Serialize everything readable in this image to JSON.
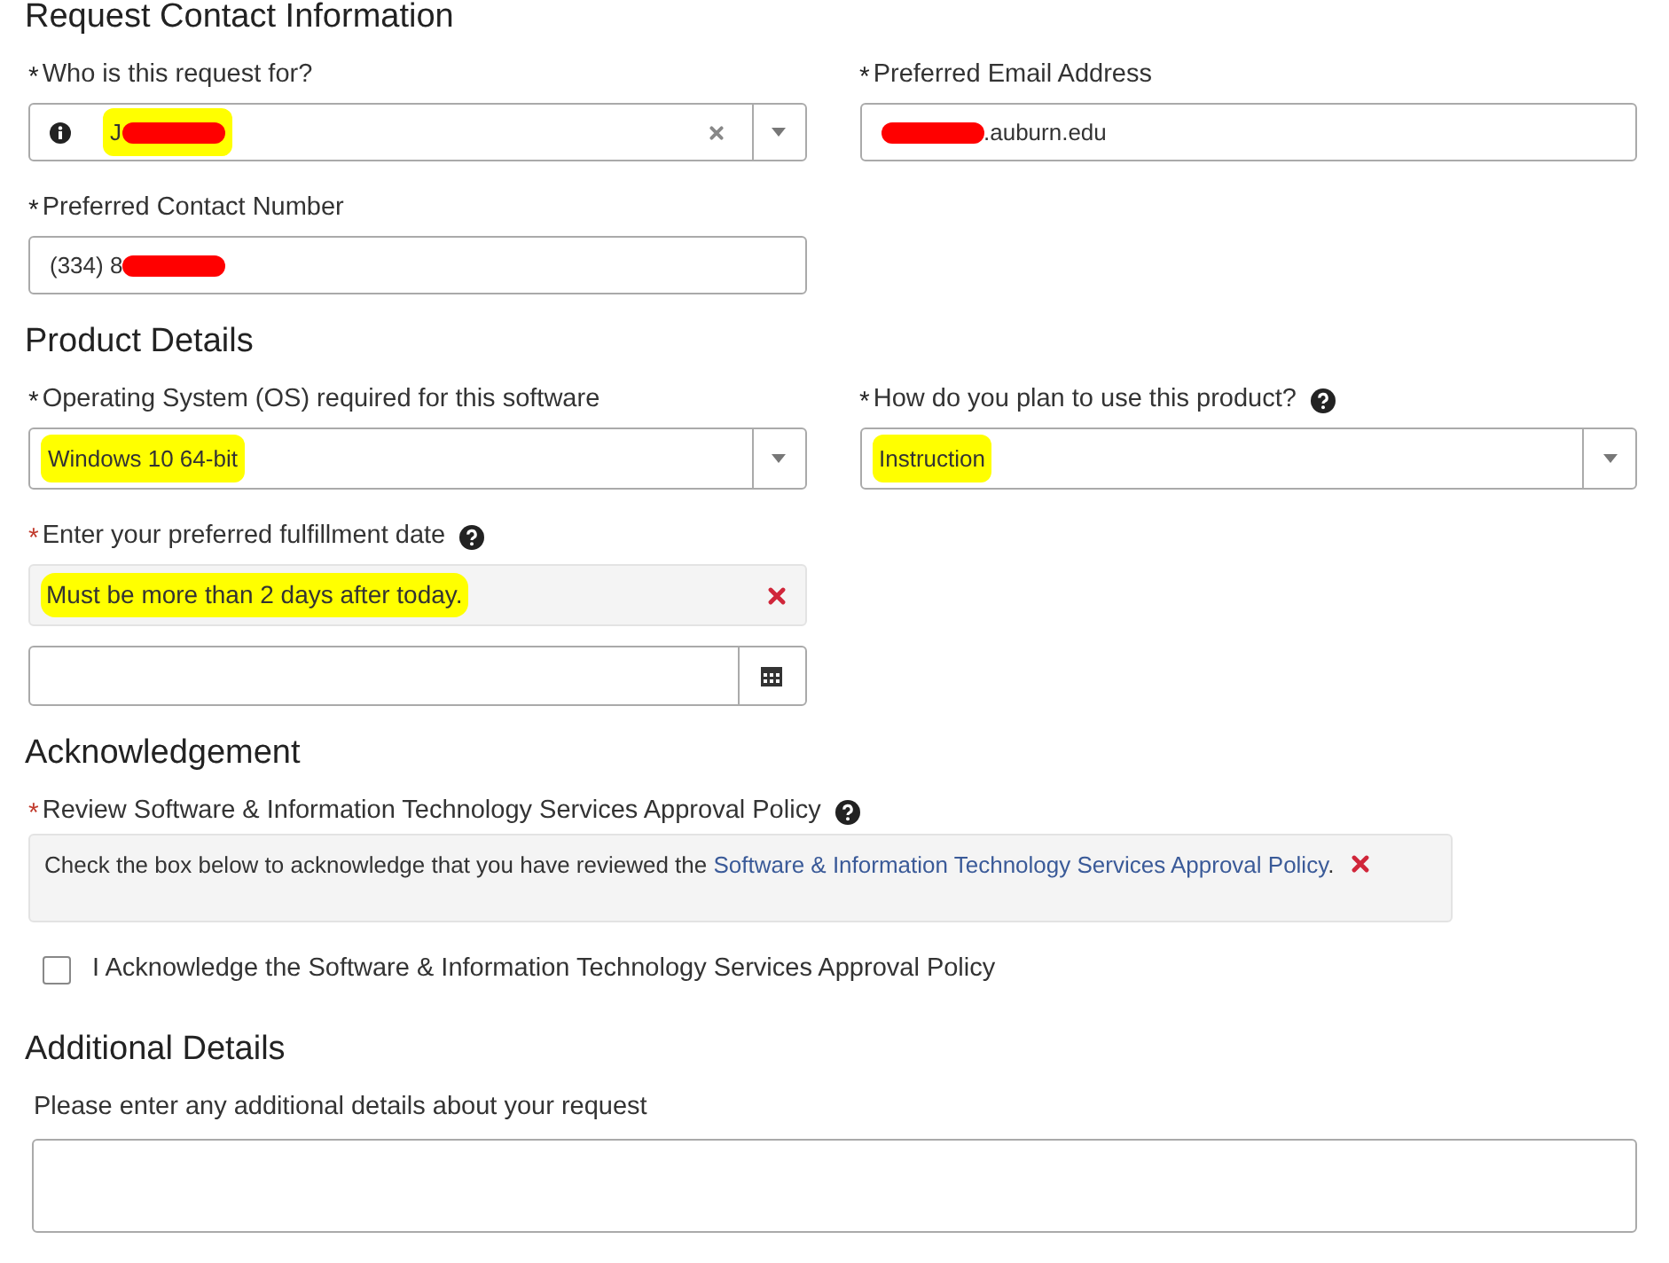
{
  "sections": [
    {
      "title": "Request Contact Information",
      "left": [
        {
          "kind": "combo",
          "required_mark": "*",
          "label": "Who is this request for?",
          "invalid": false,
          "value": [
            {
              "kind": "text",
              "text": "J"
            },
            {
              "kind": "redaction"
            }
          ],
          "highlighted": true
        },
        {
          "kind": "text",
          "required_mark": "*",
          "label": "Preferred Contact Number",
          "invalid": false,
          "value": [
            {
              "kind": "text",
              "text": "(334) 8"
            },
            {
              "kind": "redaction"
            }
          ]
        }
      ],
      "right": [
        {
          "kind": "text",
          "required_mark": "*",
          "label": "Preferred Email Address",
          "invalid": false,
          "value": [
            {
              "kind": "redaction"
            },
            {
              "kind": "text",
              "text": ".auburn.edu"
            }
          ]
        }
      ]
    },
    {
      "title": "Product Details",
      "left": [
        {
          "kind": "select",
          "required_mark": "*",
          "label": "Operating System (OS) required for this software",
          "invalid": false,
          "value": [
            {
              "kind": "text",
              "text": "Windows 10 64-bit"
            }
          ],
          "highlighted": true
        },
        {
          "kind": "date",
          "required_mark": "*",
          "label": "Enter your preferred fulfillment date",
          "invalid": true,
          "error": "Must be more than 2 days after today.",
          "error_highlighted": true,
          "help": true
        }
      ],
      "right": [
        {
          "kind": "select",
          "required_mark": "*",
          "label": "How do you plan to use this product?",
          "invalid": false,
          "value": [
            {
              "kind": "text",
              "text": "Instruction"
            }
          ],
          "highlighted": true,
          "help": true
        }
      ]
    },
    {
      "title": "Acknowledgement",
      "wide": [
        {
          "kind": "notice",
          "required_mark": "*",
          "label": "Review Software & Information Technology Services Approval Policy",
          "invalid": true,
          "help": true,
          "text": "Check the box below to acknowledge that you have reviewed the ",
          "link": "Software & Information Technology Services Approval Policy",
          "after": "."
        },
        {
          "kind": "checkbox",
          "label": "I Acknowledge the Software & Information Technology Services Approval Policy",
          "checked": false
        }
      ]
    },
    {
      "title": "Additional Details",
      "wide": [
        {
          "kind": "textarea",
          "label": "Please enter any additional details about your request"
        }
      ]
    }
  ]
}
